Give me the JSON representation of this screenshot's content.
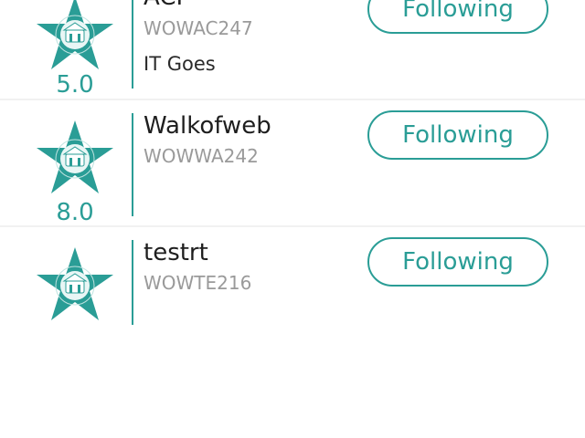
{
  "colors": {
    "accent": "#2a9d96",
    "name_text": "#1e1e1e",
    "code_text": "#9a9a9a",
    "divider": "#f1f1f1"
  },
  "items": [
    {
      "name": "ACP",
      "code": "WOWAC247",
      "description": "IT Goes",
      "rating": "5.0",
      "button_label": "Following",
      "icon": "star-badge-icon"
    },
    {
      "name": "Walkofweb",
      "code": "WOWWA242",
      "description": "",
      "rating": "8.0",
      "button_label": "Following",
      "icon": "star-badge-icon"
    },
    {
      "name": "testrt",
      "code": "WOWTE216",
      "description": "",
      "rating": "",
      "button_label": "Following",
      "icon": "star-badge-icon"
    }
  ]
}
